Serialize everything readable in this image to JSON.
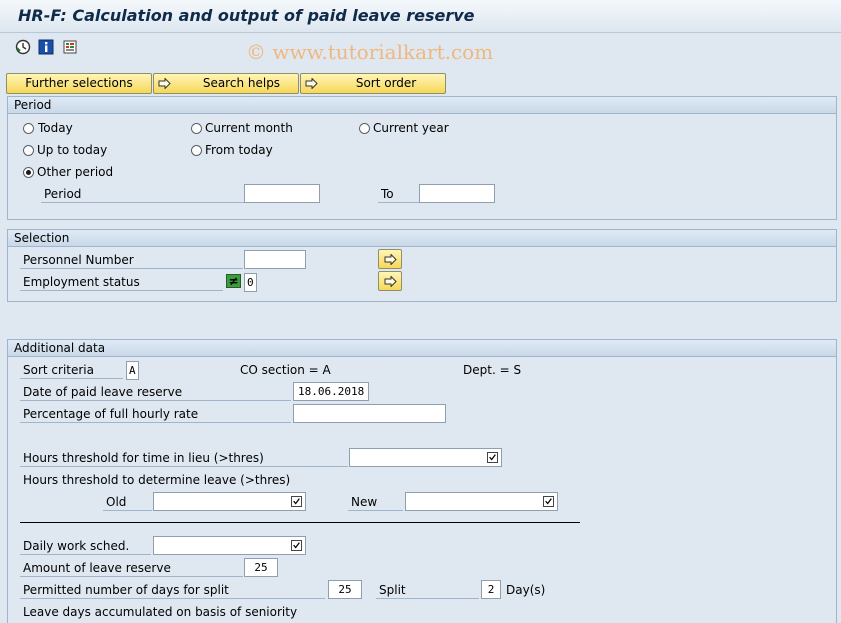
{
  "title": "HR-F: Calculation and output of paid leave reserve",
  "watermark": "© www.tutorialkart.com",
  "toolbar": {
    "icons": [
      "execute-icon",
      "info-icon",
      "selection-options-icon"
    ]
  },
  "top_buttons": {
    "further_selections": "Further selections",
    "search_helps": "Search helps",
    "sort_order": "Sort order"
  },
  "period": {
    "header": "Period",
    "today": "Today",
    "current_month": "Current month",
    "current_year": "Current year",
    "up_to_today": "Up to today",
    "from_today": "From today",
    "other_period": "Other period",
    "selected": "other_period",
    "period_label": "Period",
    "period_value": "",
    "to_label": "To",
    "to_value": ""
  },
  "selection": {
    "header": "Selection",
    "personnel_number_label": "Personnel Number",
    "personnel_number_value": "",
    "employment_status_label": "Employment status",
    "employment_status_operator": "≠",
    "employment_status_value": "0"
  },
  "additional": {
    "header": "Additional data",
    "sort_criteria_label": "Sort criteria",
    "sort_criteria_value": "A",
    "co_section": "CO section = A",
    "dept": "Dept. = S",
    "date_label": "Date of paid leave reserve",
    "date_value": "18.06.2018",
    "percentage_label": "Percentage of full hourly rate",
    "percentage_value": "",
    "hours_lieu_label": "Hours threshold for time in lieu (>thres)",
    "hours_leave_label": "Hours threshold to determine leave (>thres)",
    "old_label": "Old",
    "new_label": "New",
    "daily_work_label": "Daily work sched.",
    "amount_label": "Amount of leave reserve",
    "amount_value": "25",
    "permitted_label": "Permitted number of days for split",
    "permitted_value": "25",
    "split_label": "Split",
    "split_value": "2",
    "days_label": "Day(s)",
    "seniority_label": "Leave days accumulated on basis of seniority"
  },
  "colors": {
    "background": "#dfe8f1",
    "button_yellow": "#f6d758",
    "title_text": "#102a4a",
    "watermark": "#f0b77e"
  }
}
